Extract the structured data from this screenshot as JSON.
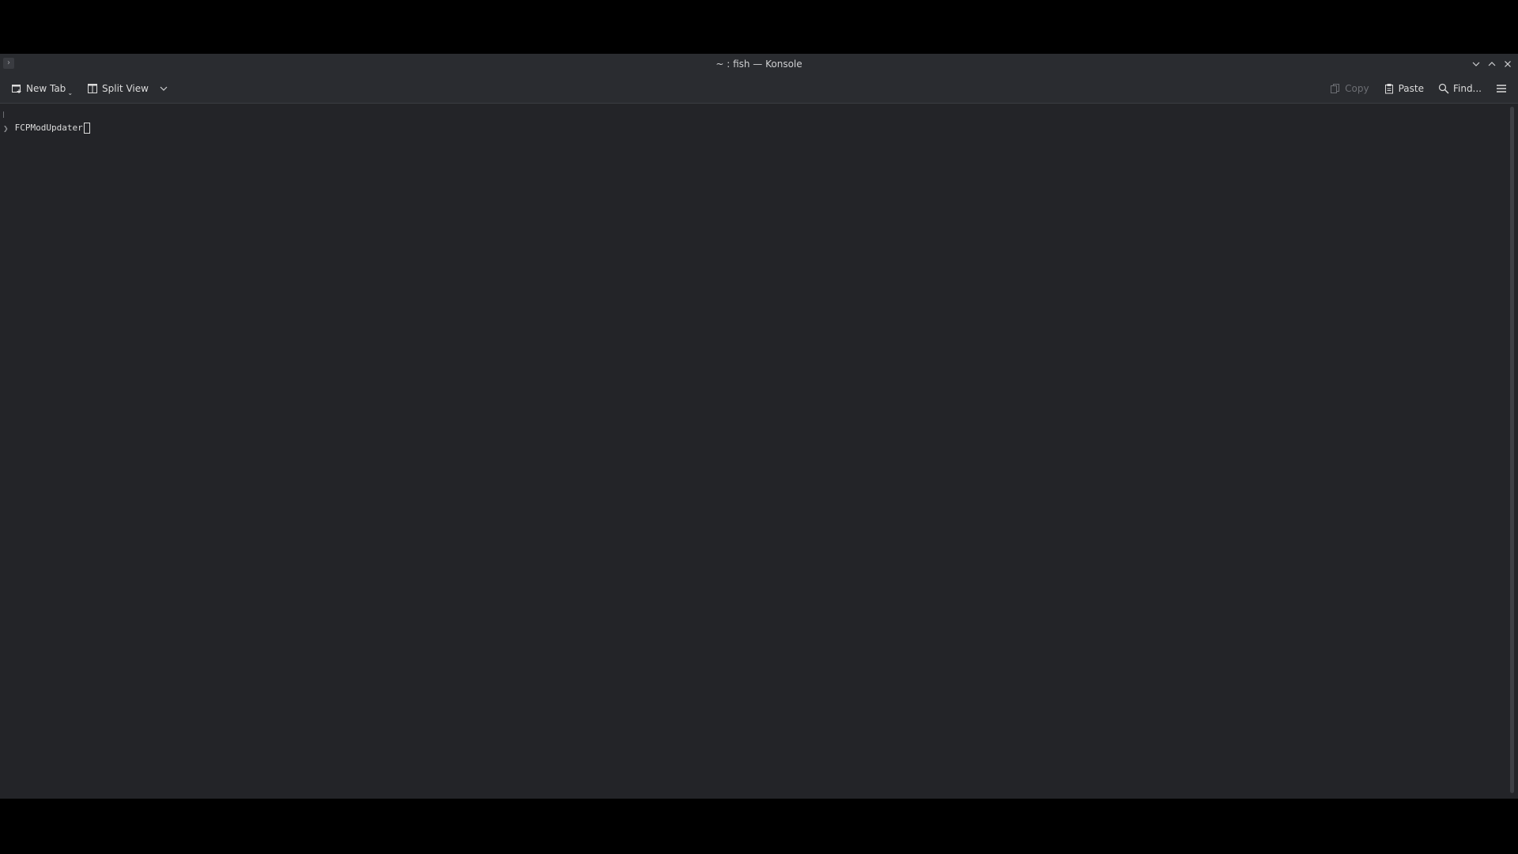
{
  "window": {
    "title": "~ : fish — Konsole"
  },
  "toolbar": {
    "new_tab_label": "New Tab",
    "split_view_label": "Split View",
    "copy_label": "Copy",
    "paste_label": "Paste",
    "find_label": "Find..."
  },
  "terminal": {
    "prompt_symbol": "❯",
    "command_text": "FCPModUpdater"
  },
  "icons": {
    "app": "konsole-icon",
    "new_tab": "new-tab-icon",
    "split_view": "split-view-icon",
    "split_dropdown": "chevron-down-icon",
    "copy": "copy-icon",
    "paste": "paste-icon",
    "find": "search-icon",
    "menu": "hamburger-menu-icon",
    "minimize": "chevron-down-icon",
    "maximize": "chevron-up-icon",
    "close": "close-icon"
  },
  "colors": {
    "terminal_background": "#232428",
    "chrome_background": "#2a2c30",
    "text": "#dcdcdc",
    "disabled_text": "#6c6e73"
  }
}
